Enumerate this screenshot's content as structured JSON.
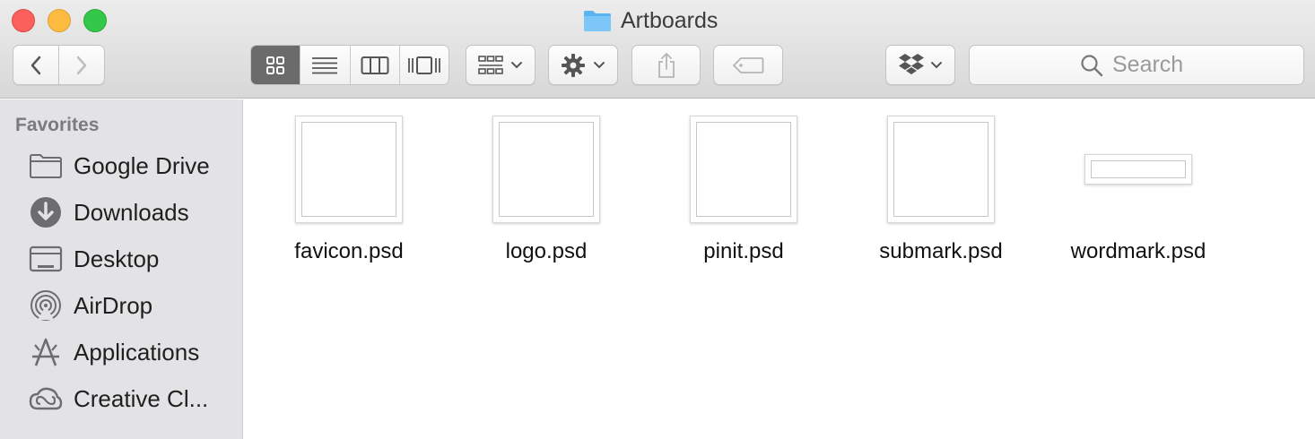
{
  "window": {
    "title": "Artboards"
  },
  "toolbar": {
    "search_placeholder": "Search"
  },
  "sidebar": {
    "heading": "Favorites",
    "items": [
      {
        "label": "Google Drive",
        "icon": "folder-icon"
      },
      {
        "label": "Downloads",
        "icon": "downloads-icon"
      },
      {
        "label": "Desktop",
        "icon": "desktop-icon"
      },
      {
        "label": "AirDrop",
        "icon": "airdrop-icon"
      },
      {
        "label": "Applications",
        "icon": "applications-icon"
      },
      {
        "label": "Creative Cl...",
        "icon": "creative-cloud-icon"
      }
    ]
  },
  "files": [
    {
      "name": "favicon.psd",
      "thumb": "square"
    },
    {
      "name": "logo.psd",
      "thumb": "square"
    },
    {
      "name": "pinit.psd",
      "thumb": "square"
    },
    {
      "name": "submark.psd",
      "thumb": "square"
    },
    {
      "name": "wordmark.psd",
      "thumb": "wide"
    }
  ],
  "colors": {
    "close": "#fc605c",
    "minimize": "#fdbc40",
    "zoom": "#34c84a",
    "folder_blue": "#5ab4f0",
    "active_segment": "#6b6b6b",
    "sidebar_bg": "#e3e3e6"
  }
}
